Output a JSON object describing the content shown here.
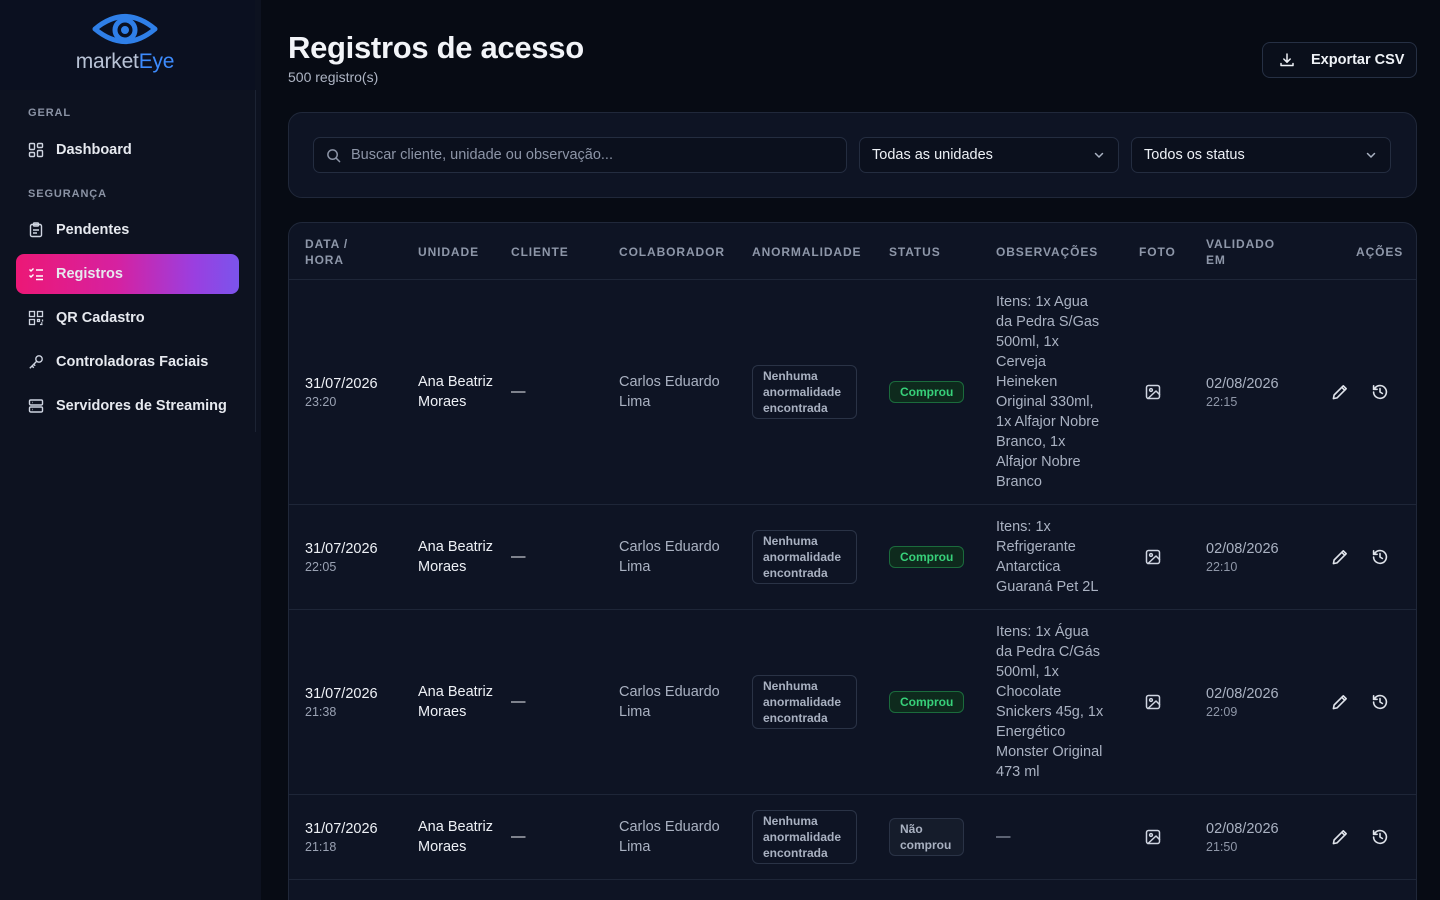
{
  "brand": {
    "name_part1": "market",
    "name_part2": "Eye",
    "accent": "#3d8bfd"
  },
  "sidebar": {
    "sections": [
      {
        "title": "GERAL"
      },
      {
        "title": "SEGURANÇA"
      }
    ],
    "items": [
      {
        "label": "Dashboard",
        "icon": "dashboard-grid-icon"
      },
      {
        "label": "Pendentes",
        "icon": "clipboard-icon"
      },
      {
        "label": "Registros",
        "icon": "list-checks-icon",
        "active": true
      },
      {
        "label": "QR Cadastro",
        "icon": "qr-code-icon"
      },
      {
        "label": "Controladoras Faciais",
        "icon": "key-icon"
      },
      {
        "label": "Servidores de Streaming",
        "icon": "server-icon"
      }
    ]
  },
  "header": {
    "title": "Registros de acesso",
    "subtitle": "500 registro(s)",
    "export_label": "Exportar CSV"
  },
  "filters": {
    "search_placeholder": "Buscar cliente, unidade ou observação...",
    "unit_select": "Todas as unidades",
    "status_select": "Todos os status"
  },
  "table": {
    "headers": {
      "datetime": "DATA / HORA",
      "unit": "UNIDADE",
      "client": "CLIENTE",
      "collaborator": "COLABORADOR",
      "anomaly": "ANORMALIDADE",
      "status": "STATUS",
      "notes": "OBSERVAÇÕES",
      "photo": "FOTO",
      "validated": "VALIDADO EM",
      "actions": "AÇÕES"
    },
    "rows": [
      {
        "date": "31/07/2026",
        "time": "23:20",
        "unit": "Ana Beatriz Moraes",
        "client": "—",
        "collaborator": "Carlos Eduardo Lima",
        "anomaly": "Nenhuma anormalidade encontrada",
        "status": "Comprou",
        "status_kind": "ok",
        "notes": "Itens: 1x Agua da Pedra S/Gas 500ml, 1x Cerveja Heineken Original 330ml, 1x Alfajor Nobre Branco, 1x Alfajor Nobre Branco",
        "validated_date": "02/08/2026",
        "validated_time": "22:15"
      },
      {
        "date": "31/07/2026",
        "time": "22:05",
        "unit": "Ana Beatriz Moraes",
        "client": "—",
        "collaborator": "Carlos Eduardo Lima",
        "anomaly": "Nenhuma anormalidade encontrada",
        "status": "Comprou",
        "status_kind": "ok",
        "notes": "Itens: 1x Refrigerante Antarctica Guaraná Pet 2L",
        "validated_date": "02/08/2026",
        "validated_time": "22:10"
      },
      {
        "date": "31/07/2026",
        "time": "21:38",
        "unit": "Ana Beatriz Moraes",
        "client": "—",
        "collaborator": "Carlos Eduardo Lima",
        "anomaly": "Nenhuma anormalidade encontrada",
        "status": "Comprou",
        "status_kind": "ok",
        "notes": "Itens: 1x Água da Pedra C/Gás 500ml, 1x Chocolate Snickers 45g, 1x Energético Monster Original 473 ml",
        "validated_date": "02/08/2026",
        "validated_time": "22:09"
      },
      {
        "date": "31/07/2026",
        "time": "21:18",
        "unit": "Ana Beatriz Moraes",
        "client": "—",
        "collaborator": "Carlos Eduardo Lima",
        "anomaly": "Nenhuma anormalidade encontrada",
        "status": "Não comprou",
        "status_kind": "no",
        "notes": "—",
        "validated_date": "02/08/2026",
        "validated_time": "21:50"
      }
    ]
  }
}
